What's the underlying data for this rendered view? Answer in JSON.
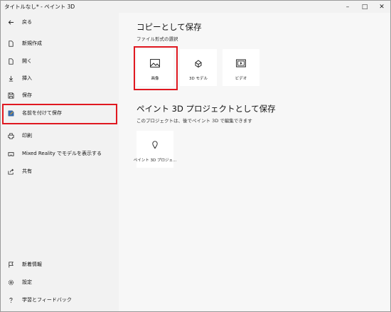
{
  "window": {
    "title": "タイトルなし* - ペイント 3D",
    "minimize": "–",
    "maximize": "□",
    "close": "✕"
  },
  "sidebar": {
    "back_label": "戻る",
    "items": [
      {
        "label": "新規作成",
        "icon": "new-file-icon"
      },
      {
        "label": "開く",
        "icon": "open-file-icon"
      },
      {
        "label": "挿入",
        "icon": "insert-icon"
      },
      {
        "label": "保存",
        "icon": "save-icon"
      },
      {
        "label": "名前を付けて保存",
        "icon": "save-as-icon"
      },
      {
        "label": "印刷",
        "icon": "print-icon"
      },
      {
        "label": "Mixed Reality でモデルを表示する",
        "icon": "mixed-reality-icon"
      },
      {
        "label": "共有",
        "icon": "share-icon"
      }
    ],
    "bottom_items": [
      {
        "label": "新着情報",
        "icon": "flag-icon"
      },
      {
        "label": "設定",
        "icon": "gear-icon"
      },
      {
        "label": "学習とフィードバック",
        "icon": "help-icon"
      }
    ]
  },
  "main": {
    "copy_section": {
      "title": "コピーとして保存",
      "subtitle": "ファイル形式の選択",
      "tiles": [
        {
          "label": "画像",
          "icon": "image-icon"
        },
        {
          "label": "3D モデル",
          "icon": "3d-model-icon"
        },
        {
          "label": "ビデオ",
          "icon": "video-icon"
        }
      ]
    },
    "project_section": {
      "title": "ペイント 3D プロジェクトとして保存",
      "subtitle": "このプロジェクトは、後でペイント 3D で編集できます",
      "tiles": [
        {
          "label": "ペイント 3D プロジェ...",
          "icon": "paint3d-project-icon"
        }
      ]
    }
  },
  "accent_colors": {
    "highlight_red": "#e01820"
  }
}
